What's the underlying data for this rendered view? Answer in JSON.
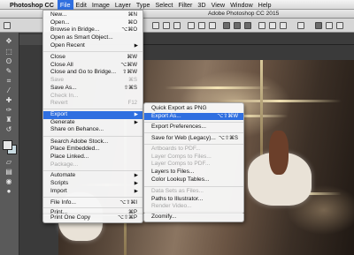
{
  "menubar": {
    "apple": "",
    "items": [
      {
        "label": "Photoshop CC"
      },
      {
        "label": "File"
      },
      {
        "label": "Edit"
      },
      {
        "label": "Image"
      },
      {
        "label": "Layer"
      },
      {
        "label": "Type"
      },
      {
        "label": "Select"
      },
      {
        "label": "Filter"
      },
      {
        "label": "3D"
      },
      {
        "label": "View"
      },
      {
        "label": "Window"
      },
      {
        "label": "Help"
      }
    ]
  },
  "window": {
    "title": "Adobe Photoshop CC 2015"
  },
  "file_menu": {
    "items": [
      {
        "label": "New...",
        "shortcut": "⌘N"
      },
      {
        "label": "Open...",
        "shortcut": "⌘O"
      },
      {
        "label": "Browse in Bridge...",
        "shortcut": "⌥⌘O"
      },
      {
        "label": "Open as Smart Object...",
        "shortcut": ""
      },
      {
        "label": "Open Recent",
        "shortcut": "▶"
      },
      {
        "label": "Close",
        "shortcut": "⌘W"
      },
      {
        "label": "Close All",
        "shortcut": "⌥⌘W"
      },
      {
        "label": "Close and Go to Bridge...",
        "shortcut": "⇧⌘W"
      },
      {
        "label": "Save",
        "shortcut": "⌘S"
      },
      {
        "label": "Save As...",
        "shortcut": "⇧⌘S"
      },
      {
        "label": "Check In...",
        "shortcut": ""
      },
      {
        "label": "Revert",
        "shortcut": "F12"
      },
      {
        "label": "Export",
        "shortcut": "▶"
      },
      {
        "label": "Generate",
        "shortcut": "▶"
      },
      {
        "label": "Share on Behance...",
        "shortcut": ""
      },
      {
        "label": "Search Adobe Stock...",
        "shortcut": ""
      },
      {
        "label": "Place Embedded...",
        "shortcut": ""
      },
      {
        "label": "Place Linked...",
        "shortcut": ""
      },
      {
        "label": "Package...",
        "shortcut": ""
      },
      {
        "label": "Automate",
        "shortcut": "▶"
      },
      {
        "label": "Scripts",
        "shortcut": "▶"
      },
      {
        "label": "Import",
        "shortcut": "▶"
      },
      {
        "label": "File Info...",
        "shortcut": "⌥⇧⌘I"
      },
      {
        "label": "Print...",
        "shortcut": "⌘P"
      },
      {
        "label": "Print One Copy",
        "shortcut": "⌥⇧⌘P"
      }
    ]
  },
  "export_menu": {
    "items": [
      {
        "label": "Quick Export as PNG",
        "shortcut": ""
      },
      {
        "label": "Export As...",
        "shortcut": "⌥⇧⌘W"
      },
      {
        "label": "Export Preferences...",
        "shortcut": ""
      },
      {
        "label": "Save for Web (Legacy)...",
        "shortcut": "⌥⇧⌘S"
      },
      {
        "label": "Artboards to PDF...",
        "shortcut": ""
      },
      {
        "label": "Layer Comps to Files...",
        "shortcut": ""
      },
      {
        "label": "Layer Comps to PDF...",
        "shortcut": ""
      },
      {
        "label": "Layers to Files...",
        "shortcut": ""
      },
      {
        "label": "Color Lookup Tables...",
        "shortcut": ""
      },
      {
        "label": "Data Sets as Files...",
        "shortcut": ""
      },
      {
        "label": "Paths to Illustrator...",
        "shortcut": ""
      },
      {
        "label": "Render Video...",
        "shortcut": ""
      },
      {
        "label": "Zoomify...",
        "shortcut": ""
      }
    ]
  },
  "toolbox": {
    "icons": [
      "move-icon",
      "marquee-icon",
      "lasso-icon",
      "quick-select-icon",
      "crop-icon",
      "eyedropper-icon",
      "healing-brush-icon",
      "brush-icon",
      "clone-stamp-icon",
      "history-brush-icon",
      "eraser-icon",
      "gradient-icon",
      "blur-icon",
      "dodge-icon"
    ]
  },
  "colors": {
    "menu_highlight": "#2f6fe0",
    "menu_bg": "#f6f6f6",
    "disabled_text": "#a6a6a6",
    "workspace": "#535353"
  }
}
